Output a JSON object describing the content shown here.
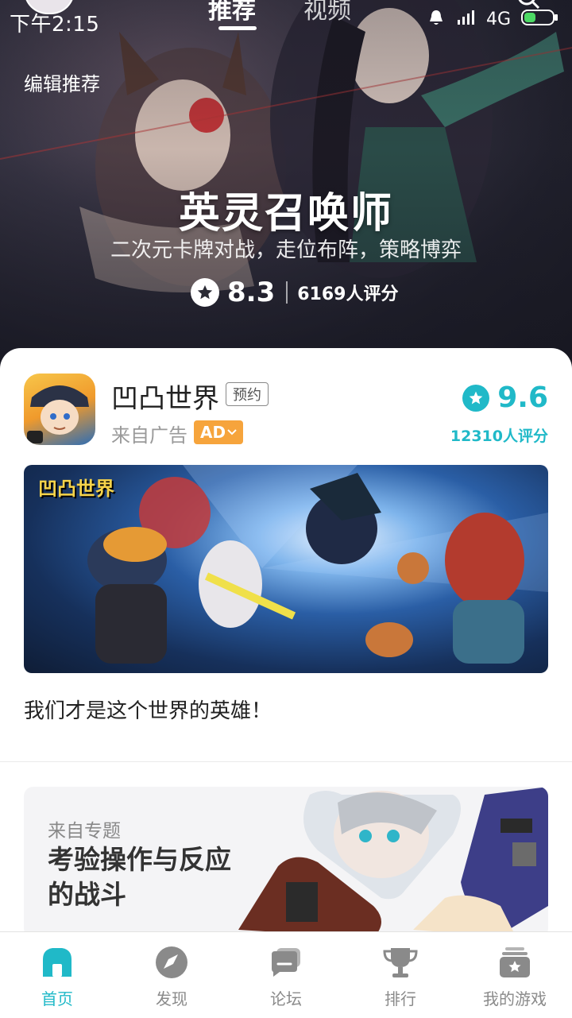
{
  "status_bar": {
    "time": "下午2:15",
    "network": "4G"
  },
  "header": {
    "tabs": [
      {
        "label": "推荐",
        "active": true
      },
      {
        "label": "视频",
        "active": false
      }
    ],
    "edit_label": "编辑推荐"
  },
  "hero": {
    "title": "英灵召唤师",
    "subtitle": "二次元卡牌对战，走位布阵，策略博弈",
    "score": "8.3",
    "rating_count": "6169人评分"
  },
  "app_card": {
    "name": "凹凸世界",
    "tag": "预约",
    "source": "来自广告",
    "ad_label": "AD",
    "score": "9.6",
    "rating_count": "12310人评分",
    "banner_logo": "凹凸世界",
    "description": "我们才是这个世界的英雄！"
  },
  "topic_card": {
    "source": "来自专题",
    "title": "考验操作与反应的战斗"
  },
  "bottom_nav": [
    {
      "label": "首页",
      "icon": "home-icon",
      "active": true
    },
    {
      "label": "发现",
      "icon": "compass-icon",
      "active": false
    },
    {
      "label": "论坛",
      "icon": "forum-icon",
      "active": false
    },
    {
      "label": "排行",
      "icon": "trophy-icon",
      "active": false
    },
    {
      "label": "我的游戏",
      "icon": "my-games-icon",
      "active": false
    }
  ],
  "colors": {
    "accent": "#20b9c8",
    "ad_badge": "#f6a43c",
    "nav_inactive": "#8a8a8a"
  }
}
